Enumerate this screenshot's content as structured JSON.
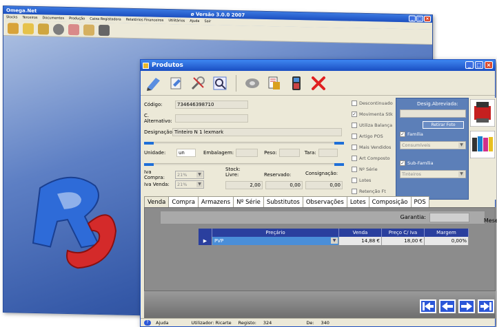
{
  "back_window": {
    "app_name": "Omega.Net",
    "title": "ø Versão 3.0.0 2007",
    "menu": [
      "Stocks",
      "Terceiros",
      "Documentos",
      "Produção",
      "Caixa Registadora",
      "Relatórios Financeiros",
      "Utilitários",
      "Ajuda",
      "Sair"
    ]
  },
  "window": {
    "title": "Produtos"
  },
  "toolbar": {
    "icons": [
      "edit-icon",
      "new-icon",
      "tools-icon",
      "search-icon",
      "tape-icon",
      "print-icon",
      "calculator-icon",
      "delete-icon"
    ]
  },
  "form": {
    "codigo_label": "Código:",
    "codigo_value": "734646398710",
    "c_alternativo_label": "C. Alternativo:",
    "c_alternativo_value": "",
    "designacao_label": "Designação:",
    "designacao_value": "Tinteiro N 1 lexmark",
    "unidade_label": "Unidade:",
    "unidade_value": "un",
    "embalagem_label": "Embalagem:",
    "peso_label": "Peso:",
    "tara_label": "Tara:",
    "iva_compra_label": "Iva Compra:",
    "iva_compra_value": "21%",
    "iva_venda_label": "Iva Venda:",
    "iva_venda_value": "21%",
    "stock_label": "Stock:",
    "livre_label": "Livre:",
    "livre_value": "2,00",
    "reservado_label": "Reservado:",
    "reservado_value": "0,00",
    "consignacao_label": "Consignação:",
    "consignacao_value": "0,00"
  },
  "checkboxes": [
    {
      "label": "Descontinuado",
      "checked": false
    },
    {
      "label": "Movimenta Stk",
      "checked": true
    },
    {
      "label": "Utiliza Balança",
      "checked": false
    },
    {
      "label": "Artigo POS",
      "checked": false
    },
    {
      "label": "Mais Vendidos",
      "checked": false
    },
    {
      "label": "Art Composto",
      "checked": false
    },
    {
      "label": "Nº Série",
      "checked": false
    },
    {
      "label": "Lotes",
      "checked": false
    },
    {
      "label": "Retenção Ft",
      "checked": false
    }
  ],
  "right_panel": {
    "desig_abreviada_label": "Desig.Abreviada:",
    "retirar_foto_label": "Retirar Foto",
    "familia_label": "Família",
    "familia_value": "Consumíveis",
    "sub_familia_label": "Sub-Família",
    "sub_familia_value": "Tinteiros"
  },
  "tabs": [
    "Venda",
    "Compra",
    "Armazens",
    "Nº Série",
    "Substitutos",
    "Observações",
    "Lotes",
    "Composição",
    "POS"
  ],
  "venda": {
    "garantia_label": "Garantia:",
    "meses_label": "Meses",
    "columns": [
      "Preçário",
      "Venda",
      "Preço C/ Iva",
      "Margem"
    ],
    "rows": [
      {
        "precario": "PVP",
        "venda": "14,88 €",
        "preco_iva": "18,00 €",
        "margem": "0,00%"
      }
    ]
  },
  "nav_icons": [
    "first-icon",
    "previous-icon",
    "next-icon",
    "last-icon"
  ],
  "status": {
    "ajuda": "Ajuda",
    "utilizador": "Utilizador: Ricarte",
    "registo": "Registo:",
    "registo_value": "324",
    "de": "De:",
    "de_value": "340"
  },
  "colors": {
    "titlebar": "#1a4ec2",
    "panel_blue": "#5c7fb8",
    "grid_header": "#2a3f9e",
    "nav_blue": "#2b57d8"
  }
}
